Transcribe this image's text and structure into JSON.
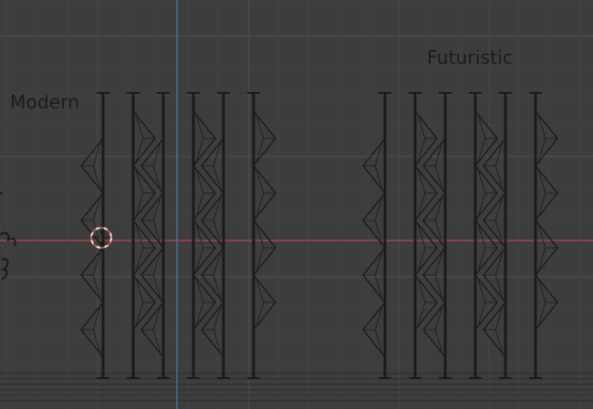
{
  "viewport": {
    "labels": {
      "modern": "Modern",
      "futuristic": "Futuristic"
    },
    "colors": {
      "background": "#3d3d3d",
      "grid_minor": "#444444",
      "grid_major": "#4c4c4c",
      "x_axis": "#b5474f",
      "y_axis": "#5272a8",
      "geometry": "#1b1b1b",
      "cursor": "#e6e6e6",
      "cursor_dash": "#d24b4b"
    },
    "groups": [
      {
        "name": "modern-panel-group",
        "pole_count": 6
      },
      {
        "name": "futuristic-panel-group",
        "pole_count": 6
      }
    ],
    "cursor_icon": "3d-cursor-icon"
  }
}
